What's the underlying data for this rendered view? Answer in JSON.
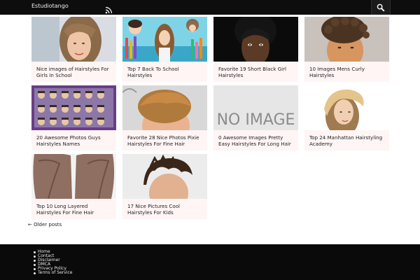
{
  "site": {
    "title": "Estudiotango"
  },
  "header": {
    "rss_icon": "rss-icon",
    "search_icon": "search-icon"
  },
  "posts": [
    {
      "title": "Nice images of Hairstyles For Girls In School",
      "thumb": "photo-girl-blonde"
    },
    {
      "title": "Top 7 Back To School Hairstyles",
      "thumb": "collage-school-hairstyles"
    },
    {
      "title": "Favorite 19 Short Black Girl Hairstyles",
      "thumb": "photo-black-girl-short-hair"
    },
    {
      "title": "10 Images Mens Curly Hairstyles",
      "thumb": "photo-man-curly-hair"
    },
    {
      "title": "20 Awesome Photos Guys Hairstyles Names",
      "thumb": "grid-guys-hairstyles"
    },
    {
      "title": "Favorite 28 Nice Photos Pixie Hairstyles For Fine Hair",
      "thumb": "photo-pixie-hair"
    },
    {
      "title": "0 Awesome Images Pretty Easy Hairstyles For Long Hair",
      "thumb": "placeholder",
      "placeholder_text": "NO IMAGE"
    },
    {
      "title": "Top 24 Manhattan Hairstyling Academy",
      "thumb": "photo-blonde-short-bob"
    },
    {
      "title": "Top 10 Long Layered Hairstyles For Fine Hair",
      "thumb": "photo-long-layered-hair"
    },
    {
      "title": "17 Nice Pictures Cool Hairstyles For Kids",
      "thumb": "photo-kid-haircut"
    }
  ],
  "pagination": {
    "older_label": "← Older posts"
  },
  "footer": {
    "links": [
      "Home",
      "Contact",
      "Disclaimer",
      "DMCA",
      "Privacy Policy",
      "Terms of Service"
    ]
  },
  "colors": {
    "topbar": "#0d0d0d",
    "card_bg": "#fff5f5",
    "footer": "#0a0a0a",
    "rss": "#e8e8e8"
  }
}
